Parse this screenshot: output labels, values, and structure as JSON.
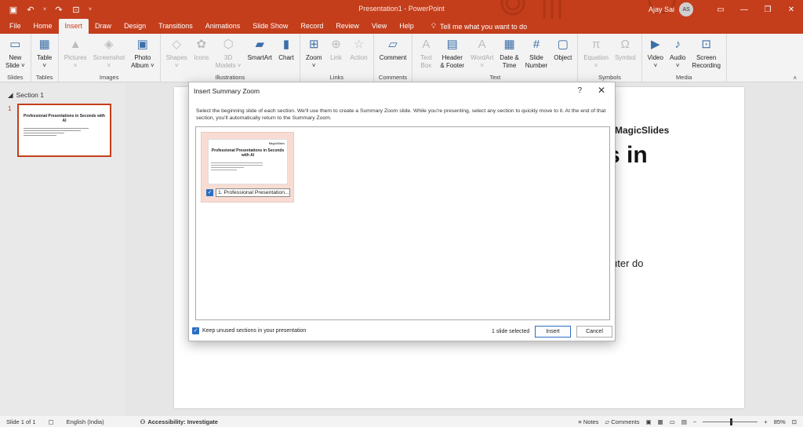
{
  "app": {
    "window_title": "Presentation1 - PowerPoint",
    "user_name": "Ajay Sai",
    "user_initials": "AS"
  },
  "menu": {
    "tabs": [
      "File",
      "Home",
      "Insert",
      "Draw",
      "Design",
      "Transitions",
      "Animations",
      "Slide Show",
      "Record",
      "Review",
      "View",
      "Help"
    ],
    "active_tab": "Insert",
    "tell_me": "Tell me what you want to do"
  },
  "ribbon": {
    "groups": [
      {
        "label": "Slides",
        "commands": [
          {
            "label": "New\nSlide ˅",
            "icon": "new-slide-icon",
            "glyph": "▭",
            "disabled": false
          }
        ]
      },
      {
        "label": "Tables",
        "commands": [
          {
            "label": "Table\n˅",
            "icon": "table-icon",
            "glyph": "▦",
            "disabled": false
          }
        ]
      },
      {
        "label": "Images",
        "commands": [
          {
            "label": "Pictures\n˅",
            "icon": "pictures-icon",
            "glyph": "▲",
            "disabled": true
          },
          {
            "label": "Screenshot\n˅",
            "icon": "screenshot-icon",
            "glyph": "◈",
            "disabled": true
          },
          {
            "label": "Photo\nAlbum ˅",
            "icon": "photo-album-icon",
            "glyph": "▣",
            "disabled": false
          }
        ]
      },
      {
        "label": "Illustrations",
        "commands": [
          {
            "label": "Shapes\n˅",
            "icon": "shapes-icon",
            "glyph": "◇",
            "disabled": true
          },
          {
            "label": "Icons",
            "icon": "icons-icon",
            "glyph": "✿",
            "disabled": true
          },
          {
            "label": "3D\nModels ˅",
            "icon": "3d-models-icon",
            "glyph": "⬡",
            "disabled": true
          },
          {
            "label": "SmartArt",
            "icon": "smartart-icon",
            "glyph": "▰",
            "disabled": false
          },
          {
            "label": "Chart",
            "icon": "chart-icon",
            "glyph": "▮",
            "disabled": false
          }
        ]
      },
      {
        "label": "Links",
        "commands": [
          {
            "label": "Zoom\n˅",
            "icon": "zoom-icon",
            "glyph": "⊞",
            "disabled": false
          },
          {
            "label": "Link",
            "icon": "link-icon",
            "glyph": "⊕",
            "disabled": true
          },
          {
            "label": "Action",
            "icon": "action-icon",
            "glyph": "☆",
            "disabled": true
          }
        ]
      },
      {
        "label": "Comments",
        "commands": [
          {
            "label": "Comment",
            "icon": "comment-icon",
            "glyph": "▱",
            "disabled": false
          }
        ]
      },
      {
        "label": "Text",
        "commands": [
          {
            "label": "Text\nBox",
            "icon": "text-box-icon",
            "glyph": "A",
            "disabled": true
          },
          {
            "label": "Header\n& Footer",
            "icon": "header-footer-icon",
            "glyph": "▤",
            "disabled": false
          },
          {
            "label": "WordArt\n˅",
            "icon": "wordart-icon",
            "glyph": "A",
            "disabled": true
          },
          {
            "label": "Date &\nTime",
            "icon": "date-time-icon",
            "glyph": "▦",
            "disabled": false
          },
          {
            "label": "Slide\nNumber",
            "icon": "slide-number-icon",
            "glyph": "#",
            "disabled": false
          },
          {
            "label": "Object",
            "icon": "object-icon",
            "glyph": "▢",
            "disabled": false
          }
        ]
      },
      {
        "label": "Symbols",
        "commands": [
          {
            "label": "Equation\n˅",
            "icon": "equation-icon",
            "glyph": "π",
            "disabled": true
          },
          {
            "label": "Symbol",
            "icon": "symbol-icon",
            "glyph": "Ω",
            "disabled": true
          }
        ]
      },
      {
        "label": "Media",
        "commands": [
          {
            "label": "Video\n˅",
            "icon": "video-icon",
            "glyph": "▶",
            "disabled": false
          },
          {
            "label": "Audio\n˅",
            "icon": "audio-icon",
            "glyph": "♪",
            "disabled": false
          },
          {
            "label": "Screen\nRecording",
            "icon": "screen-recording-icon",
            "glyph": "⊡",
            "disabled": false
          }
        ]
      }
    ]
  },
  "thumbnails": {
    "section_name": "Section 1",
    "slide_number": "1",
    "thumb_title": "Professional Presentations in Seconds with AI"
  },
  "slide": {
    "brand": "MagicSlides",
    "big_fragment": "s in",
    "body_fragment": "uter do"
  },
  "dialog": {
    "title": "Insert Summary Zoom",
    "help": "?",
    "close": "✕",
    "description": "Select the beginning slide of each section. We'll use them to create a Summary Zoom slide. While you're presenting, select any section to quickly move to it. At the end of that section, you'll automatically return to the Summary Zoom.",
    "section_item": {
      "label": "1. Professional Presentation...",
      "checked": true,
      "thumb_title": "Professional Presentations in Seconds with AI",
      "thumb_logo": "MagicSlides"
    },
    "keep_label": "Keep unused sections in your presentation",
    "keep_checked": true,
    "selected_count": "1 slide selected",
    "insert_label": "Insert",
    "cancel_label": "Cancel"
  },
  "status": {
    "slide_info": "Slide 1 of 1",
    "language": "English (India)",
    "accessibility": "Accessibility: Investigate",
    "notes": "Notes",
    "comments": "Comments",
    "zoom": "85%"
  },
  "colors": {
    "accent": "#c43e1c",
    "checkbox": "#2b6fc4",
    "section_card": "#f8dcd3"
  }
}
